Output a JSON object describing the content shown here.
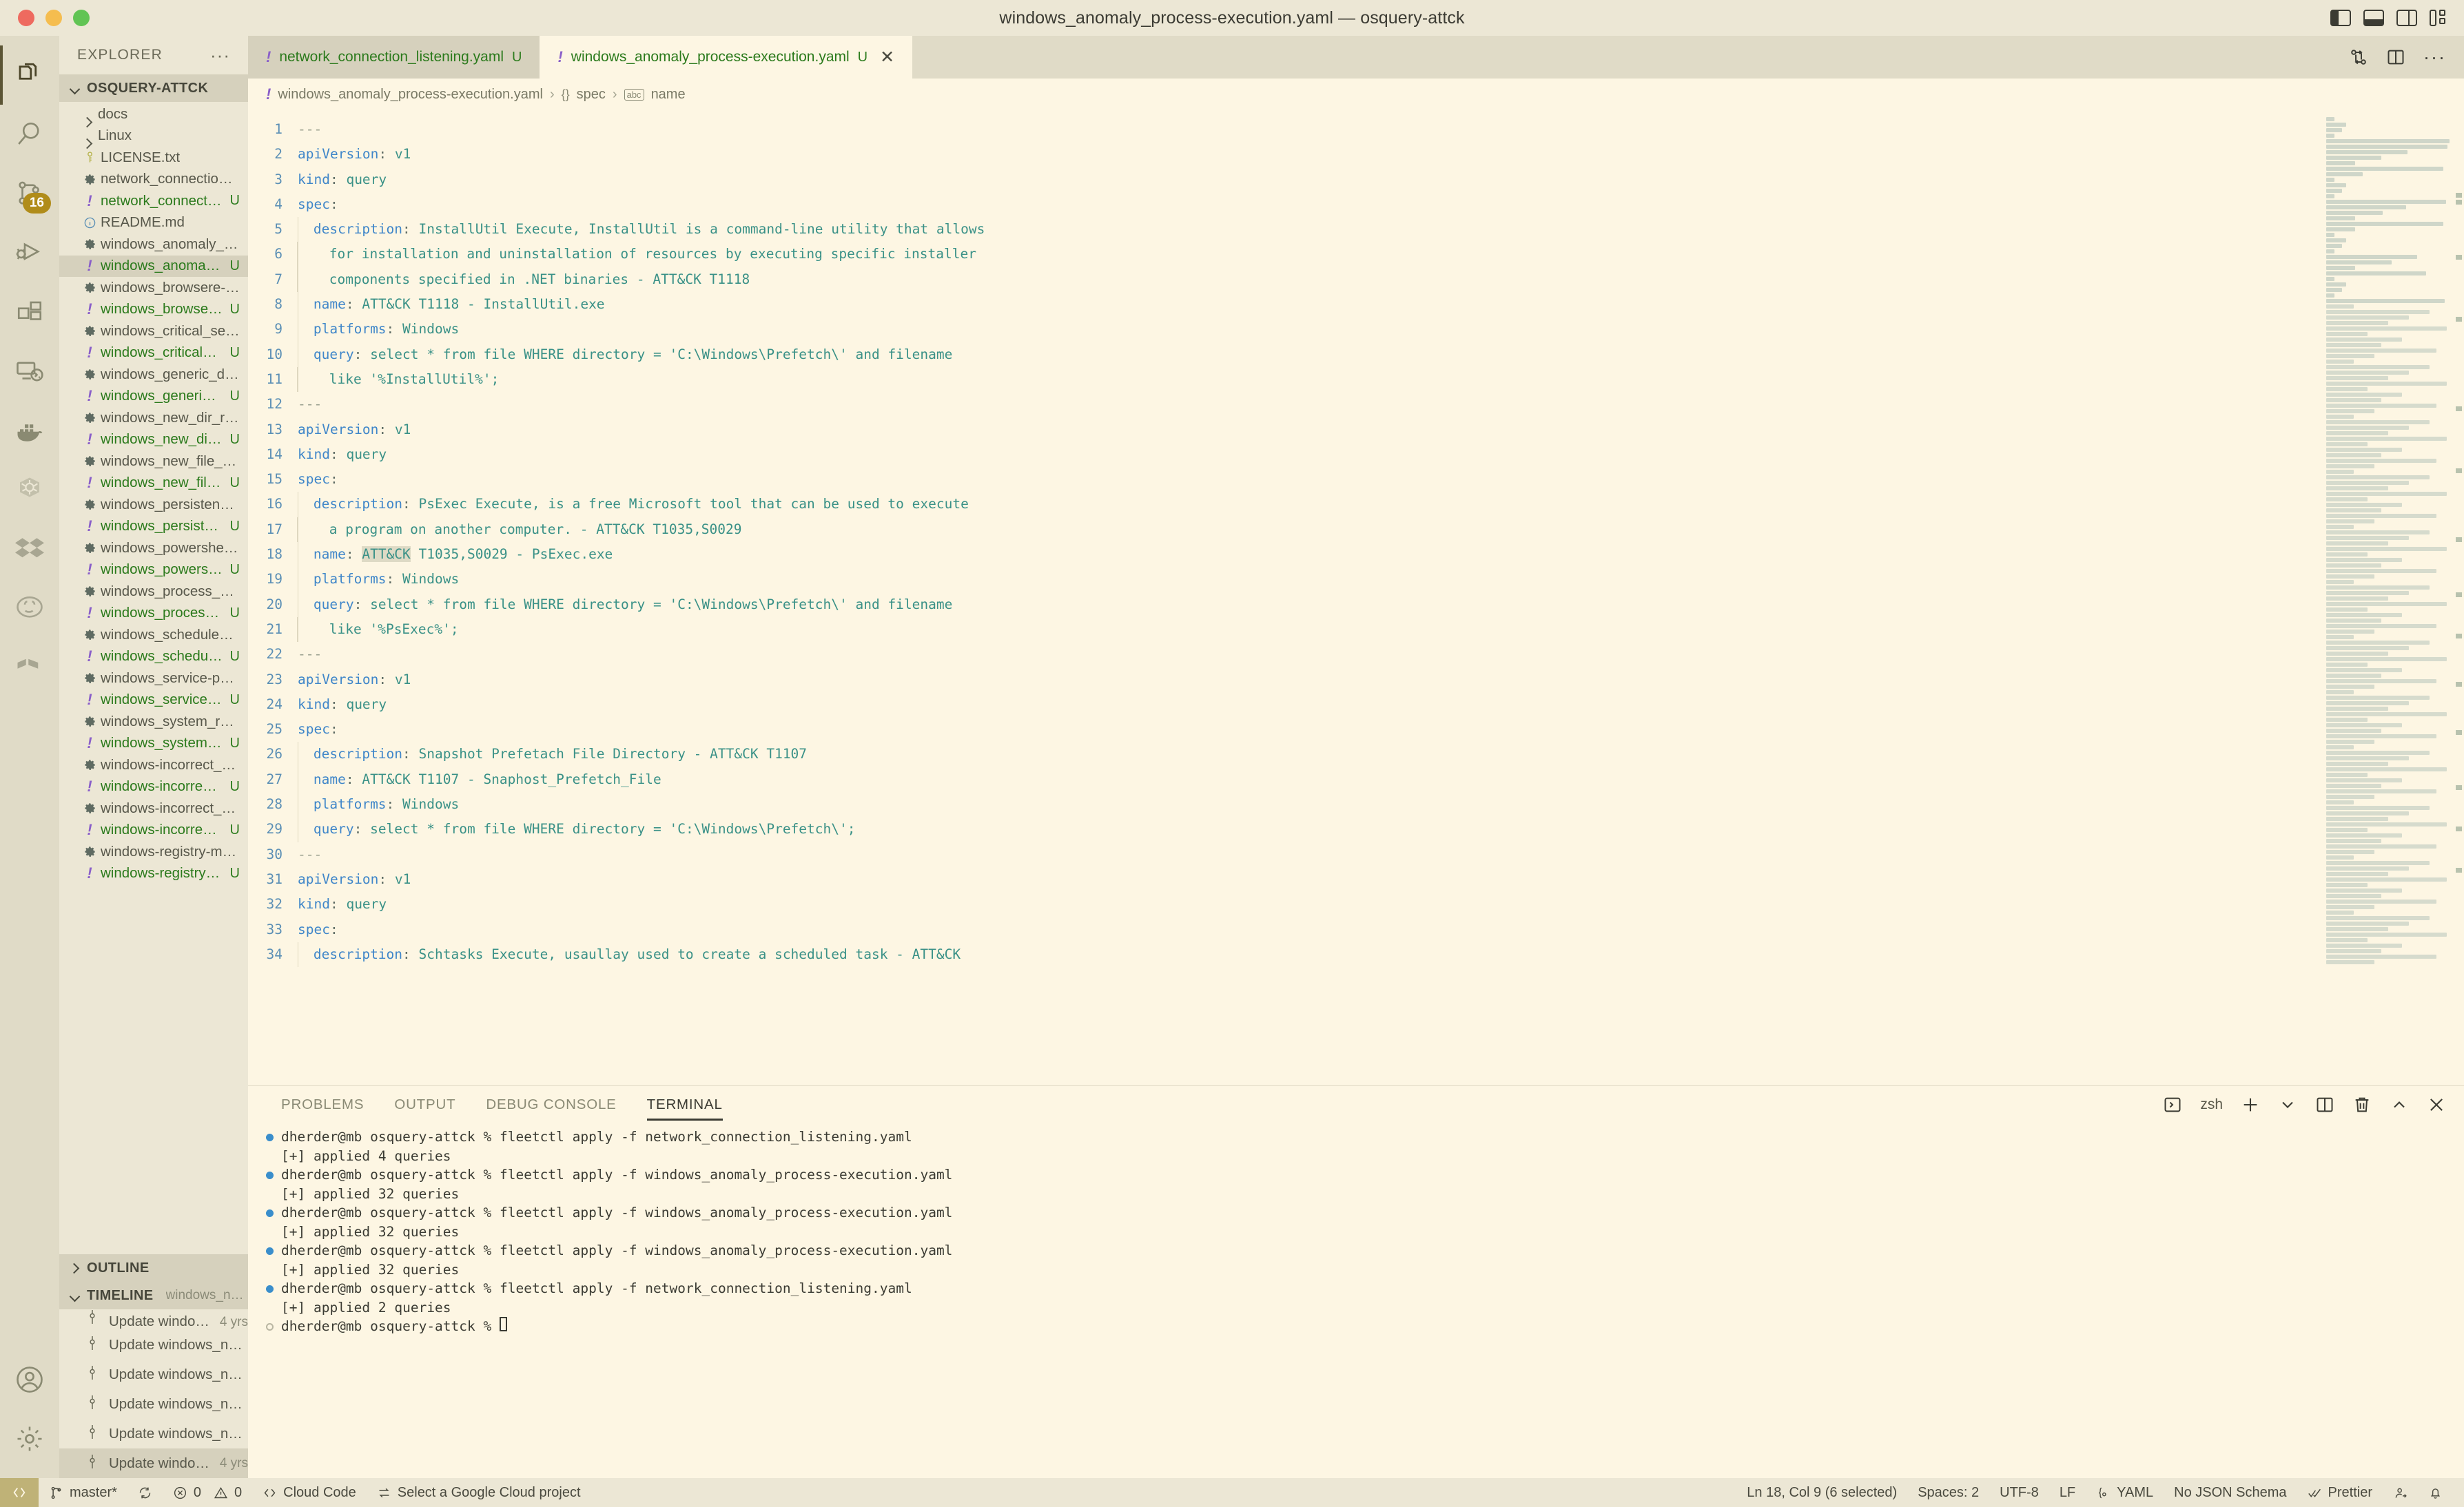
{
  "window": {
    "title": "windows_anomaly_process-execution.yaml — osquery-attck",
    "traffic_lights": [
      "close",
      "minimize",
      "maximize"
    ],
    "layout_toggles": [
      "toggle-primary-sidebar",
      "toggle-panel",
      "toggle-secondary-sidebar",
      "customize-layout"
    ]
  },
  "activitybar": {
    "items": [
      {
        "name": "explorer",
        "active": true
      },
      {
        "name": "search",
        "active": false
      },
      {
        "name": "source-control",
        "active": false,
        "badge": "16"
      },
      {
        "name": "run-and-debug",
        "active": false
      },
      {
        "name": "extensions",
        "active": false
      },
      {
        "name": "remote-explorer",
        "active": false
      },
      {
        "name": "docker",
        "active": false
      },
      {
        "name": "kubernetes",
        "active": false
      },
      {
        "name": "dropbox",
        "active": false
      },
      {
        "name": "github",
        "active": false
      },
      {
        "name": "todo-tree",
        "active": false
      }
    ],
    "bottom": [
      {
        "name": "accounts"
      },
      {
        "name": "settings-gear"
      }
    ]
  },
  "sidebar": {
    "header": "EXPLORER",
    "more_actions": "···",
    "folder": "OSQUERY-ATTCK",
    "files": [
      {
        "name": "docs",
        "type": "folder",
        "badge": ""
      },
      {
        "name": "Linux",
        "type": "folder",
        "badge": ""
      },
      {
        "name": "LICENSE.txt",
        "type": "license",
        "badge": ""
      },
      {
        "name": "network_connection_listening.conf",
        "type": "conf",
        "badge": ""
      },
      {
        "name": "network_connection_listening.yaml",
        "type": "yaml",
        "badge": "U"
      },
      {
        "name": "README.md",
        "type": "readme",
        "badge": ""
      },
      {
        "name": "windows_anomaly_process-execution.conf",
        "type": "conf",
        "badge": ""
      },
      {
        "name": "windows_anomaly_process-execution.yaml",
        "type": "yaml",
        "badge": "U",
        "selected": true
      },
      {
        "name": "windows_browsere-extensions.conf",
        "type": "conf",
        "badge": ""
      },
      {
        "name": "windows_browsere-extensions.yaml",
        "type": "yaml",
        "badge": "U"
      },
      {
        "name": "windows_critical_service_status.conf",
        "type": "conf",
        "badge": ""
      },
      {
        "name": "windows_critical_service_status.yaml",
        "type": "yaml",
        "badge": "U"
      },
      {
        "name": "windows_generic_detection.conf",
        "type": "conf",
        "badge": ""
      },
      {
        "name": "windows_generic_detection.yaml",
        "type": "yaml",
        "badge": "U"
      },
      {
        "name": "windows_new_dir_relevant_infection_path.conf",
        "type": "conf",
        "badge": ""
      },
      {
        "name": "windows_new_dir_relevant_infection_path.yaml",
        "type": "yaml",
        "badge": "U"
      },
      {
        "name": "windows_new_file_relevant_infection_path.conf",
        "type": "conf",
        "badge": ""
      },
      {
        "name": "windows_new_file_relevant_infection_path.yaml",
        "type": "yaml",
        "badge": "U"
      },
      {
        "name": "windows_persistence-startup_items.conf",
        "type": "conf",
        "badge": ""
      },
      {
        "name": "windows_persistence-startup_items.yaml",
        "type": "yaml",
        "badge": "U"
      },
      {
        "name": "windows_powershell_events.conf",
        "type": "conf",
        "badge": ""
      },
      {
        "name": "windows_powershell_events.yaml",
        "type": "yaml",
        "badge": "U"
      },
      {
        "name": "windows_process_no_disk_binary.conf",
        "type": "conf",
        "badge": ""
      },
      {
        "name": "windows_process_no_disk_binary.yaml",
        "type": "yaml",
        "badge": "U"
      },
      {
        "name": "windows_scheduled_tasks.conf",
        "type": "conf",
        "badge": ""
      },
      {
        "name": "windows_scheduled_tasks.yaml",
        "type": "yaml",
        "badge": "U"
      },
      {
        "name": "windows_service-persistence.conf",
        "type": "conf",
        "badge": ""
      },
      {
        "name": "windows_service-persistence.yaml",
        "type": "yaml",
        "badge": "U"
      },
      {
        "name": "windows_system_running_processes.conf",
        "type": "conf",
        "badge": ""
      },
      {
        "name": "windows_system_running_processes.yaml",
        "type": "yaml",
        "badge": "U"
      },
      {
        "name": "windows-incorrect_parent_process.conf",
        "type": "conf",
        "badge": ""
      },
      {
        "name": "windows-incorrect_parent_process.yaml",
        "type": "yaml",
        "badge": "U"
      },
      {
        "name": "windows-incorrect_path_process.conf",
        "type": "conf",
        "badge": ""
      },
      {
        "name": "windows-incorrect_path_process.yaml",
        "type": "yaml",
        "badge": "U"
      },
      {
        "name": "windows-registry-monitoring.conf",
        "type": "conf",
        "badge": ""
      },
      {
        "name": "windows-registry-monitoring.yaml",
        "type": "yaml",
        "badge": "U"
      }
    ],
    "outline": {
      "label": "OUTLINE",
      "expanded": false
    },
    "timeline": {
      "label": "TIMELINE",
      "subtitle": "windows_new_file_relevant_infection_path.conf (pi...",
      "entries": [
        {
          "text": "Update windows_new_file_relevant_infectio...",
          "age": "4 yrs",
          "clipped": true
        },
        {
          "text": "Update windows_new_file_relevant_infection_p...",
          "age": ""
        },
        {
          "text": "Update windows_new_file_relevant_infection_p...",
          "age": ""
        },
        {
          "text": "Update windows_new_file_relevant_infection_p...",
          "age": ""
        },
        {
          "text": "Update windows_new_file_relevant_infection_p...",
          "age": ""
        },
        {
          "text": "Update windows_new_file_relevant_infectio...",
          "age": "4 yrs",
          "selected": true
        }
      ]
    }
  },
  "editor": {
    "tabs": [
      {
        "label": "network_connection_listening.yaml",
        "badge": "U",
        "active": false,
        "closable": false
      },
      {
        "label": "windows_anomaly_process-execution.yaml",
        "badge": "U",
        "active": true,
        "closable": true,
        "close": "✕"
      }
    ],
    "actions": [
      "split-editor-toggle",
      "split-editor",
      "more-actions"
    ],
    "breadcrumb": [
      {
        "text": "windows_anomaly_process-execution.yaml",
        "icon": "yaml-icon"
      },
      {
        "text": "spec",
        "icon": "{}"
      },
      {
        "text": "name",
        "icon": "abc"
      }
    ],
    "lines": [
      {
        "n": 1,
        "segs": [
          {
            "t": "---",
            "c": "cm"
          }
        ]
      },
      {
        "n": 2,
        "segs": [
          {
            "t": "apiVersion",
            "c": "k"
          },
          {
            "t": ": ",
            "c": "p"
          },
          {
            "t": "v1",
            "c": "v"
          }
        ]
      },
      {
        "n": 3,
        "segs": [
          {
            "t": "kind",
            "c": "k"
          },
          {
            "t": ": ",
            "c": "p"
          },
          {
            "t": "query",
            "c": "v"
          }
        ]
      },
      {
        "n": 4,
        "segs": [
          {
            "t": "spec",
            "c": "k"
          },
          {
            "t": ":",
            "c": "p"
          }
        ]
      },
      {
        "n": 5,
        "indent": 1,
        "segs": [
          {
            "t": "  description",
            "c": "k"
          },
          {
            "t": ": ",
            "c": "p"
          },
          {
            "t": "InstallUtil Execute, InstallUtil is a command-line utility that allows",
            "c": "v"
          }
        ]
      },
      {
        "n": 6,
        "indent": 2,
        "segs": [
          {
            "t": "    for installation and uninstallation of resources by executing specific installer",
            "c": "v"
          }
        ]
      },
      {
        "n": 7,
        "indent": 2,
        "segs": [
          {
            "t": "    components specified in .NET binaries - ATT&CK T1118",
            "c": "v"
          }
        ]
      },
      {
        "n": 8,
        "indent": 1,
        "segs": [
          {
            "t": "  name",
            "c": "k"
          },
          {
            "t": ": ",
            "c": "p"
          },
          {
            "t": "ATT&CK T1118 - InstallUtil.exe",
            "c": "v"
          }
        ]
      },
      {
        "n": 9,
        "indent": 1,
        "segs": [
          {
            "t": "  platforms",
            "c": "k"
          },
          {
            "t": ": ",
            "c": "p"
          },
          {
            "t": "Windows",
            "c": "v"
          }
        ]
      },
      {
        "n": 10,
        "indent": 1,
        "segs": [
          {
            "t": "  query",
            "c": "k"
          },
          {
            "t": ": ",
            "c": "p"
          },
          {
            "t": "select * from file WHERE directory = 'C:\\Windows\\Prefetch\\' and filename",
            "c": "v"
          }
        ]
      },
      {
        "n": 11,
        "indent": 2,
        "segs": [
          {
            "t": "    like '%InstallUtil%';",
            "c": "v"
          }
        ]
      },
      {
        "n": 12,
        "segs": [
          {
            "t": "---",
            "c": "cm"
          }
        ]
      },
      {
        "n": 13,
        "segs": [
          {
            "t": "apiVersion",
            "c": "k"
          },
          {
            "t": ": ",
            "c": "p"
          },
          {
            "t": "v1",
            "c": "v"
          }
        ]
      },
      {
        "n": 14,
        "segs": [
          {
            "t": "kind",
            "c": "k"
          },
          {
            "t": ": ",
            "c": "p"
          },
          {
            "t": "query",
            "c": "v"
          }
        ]
      },
      {
        "n": 15,
        "segs": [
          {
            "t": "spec",
            "c": "k"
          },
          {
            "t": ":",
            "c": "p"
          }
        ]
      },
      {
        "n": 16,
        "indent": 1,
        "segs": [
          {
            "t": "  description",
            "c": "k"
          },
          {
            "t": ": ",
            "c": "p"
          },
          {
            "t": "PsExec Execute, is a free Microsoft tool that can be used to execute",
            "c": "v"
          }
        ]
      },
      {
        "n": 17,
        "indent": 2,
        "segs": [
          {
            "t": "    a program on another computer. - ATT&CK T1035,S0029",
            "c": "v"
          }
        ]
      },
      {
        "n": 18,
        "indent": 1,
        "segs": [
          {
            "t": "  name",
            "c": "k"
          },
          {
            "t": ": ",
            "c": "p"
          },
          {
            "t": "ATT&CK",
            "c": "v",
            "sel": true
          },
          {
            "t": " T1035,S0029 - PsExec.exe",
            "c": "v"
          }
        ]
      },
      {
        "n": 19,
        "indent": 1,
        "segs": [
          {
            "t": "  platforms",
            "c": "k"
          },
          {
            "t": ": ",
            "c": "p"
          },
          {
            "t": "Windows",
            "c": "v"
          }
        ]
      },
      {
        "n": 20,
        "indent": 1,
        "segs": [
          {
            "t": "  query",
            "c": "k"
          },
          {
            "t": ": ",
            "c": "p"
          },
          {
            "t": "select * from file WHERE directory = 'C:\\Windows\\Prefetch\\' and filename",
            "c": "v"
          }
        ]
      },
      {
        "n": 21,
        "indent": 2,
        "segs": [
          {
            "t": "    like '%PsExec%';",
            "c": "v"
          }
        ]
      },
      {
        "n": 22,
        "segs": [
          {
            "t": "---",
            "c": "cm"
          }
        ]
      },
      {
        "n": 23,
        "segs": [
          {
            "t": "apiVersion",
            "c": "k"
          },
          {
            "t": ": ",
            "c": "p"
          },
          {
            "t": "v1",
            "c": "v"
          }
        ]
      },
      {
        "n": 24,
        "segs": [
          {
            "t": "kind",
            "c": "k"
          },
          {
            "t": ": ",
            "c": "p"
          },
          {
            "t": "query",
            "c": "v"
          }
        ]
      },
      {
        "n": 25,
        "segs": [
          {
            "t": "spec",
            "c": "k"
          },
          {
            "t": ":",
            "c": "p"
          }
        ]
      },
      {
        "n": 26,
        "indent": 1,
        "segs": [
          {
            "t": "  description",
            "c": "k"
          },
          {
            "t": ": ",
            "c": "p"
          },
          {
            "t": "Snapshot Prefetach File Directory - ATT&CK T1107",
            "c": "v"
          }
        ]
      },
      {
        "n": 27,
        "indent": 1,
        "segs": [
          {
            "t": "  name",
            "c": "k"
          },
          {
            "t": ": ",
            "c": "p"
          },
          {
            "t": "ATT&CK T1107 - Snaphost_Prefetch_File",
            "c": "v"
          }
        ]
      },
      {
        "n": 28,
        "indent": 1,
        "segs": [
          {
            "t": "  platforms",
            "c": "k"
          },
          {
            "t": ": ",
            "c": "p"
          },
          {
            "t": "Windows",
            "c": "v"
          }
        ]
      },
      {
        "n": 29,
        "indent": 1,
        "segs": [
          {
            "t": "  query",
            "c": "k"
          },
          {
            "t": ": ",
            "c": "p"
          },
          {
            "t": "select * from file WHERE directory = 'C:\\Windows\\Prefetch\\';",
            "c": "v"
          }
        ]
      },
      {
        "n": 30,
        "segs": [
          {
            "t": "---",
            "c": "cm"
          }
        ]
      },
      {
        "n": 31,
        "segs": [
          {
            "t": "apiVersion",
            "c": "k"
          },
          {
            "t": ": ",
            "c": "p"
          },
          {
            "t": "v1",
            "c": "v"
          }
        ]
      },
      {
        "n": 32,
        "segs": [
          {
            "t": "kind",
            "c": "k"
          },
          {
            "t": ": ",
            "c": "p"
          },
          {
            "t": "query",
            "c": "v"
          }
        ]
      },
      {
        "n": 33,
        "segs": [
          {
            "t": "spec",
            "c": "k"
          },
          {
            "t": ":",
            "c": "p"
          }
        ]
      },
      {
        "n": 34,
        "indent": 1,
        "segs": [
          {
            "t": "  description",
            "c": "k"
          },
          {
            "t": ": ",
            "c": "p"
          },
          {
            "t": "Schtasks Execute, usaullay used to create a scheduled task - ATT&CK",
            "c": "v"
          }
        ]
      }
    ]
  },
  "panel": {
    "tabs": [
      {
        "label": "PROBLEMS",
        "active": false
      },
      {
        "label": "OUTPUT",
        "active": false
      },
      {
        "label": "DEBUG CONSOLE",
        "active": false
      },
      {
        "label": "TERMINAL",
        "active": true
      }
    ],
    "shell": "zsh",
    "actions": [
      "new-terminal",
      "terminal-dropdown",
      "split-terminal",
      "kill-terminal",
      "maximize-panel",
      "close-panel"
    ],
    "terminal_lines": [
      {
        "dot": "blue",
        "text": "dherder@mb osquery-attck % fleetctl apply -f network_connection_listening.yaml"
      },
      {
        "dot": "none",
        "text": "[+] applied 4 queries"
      },
      {
        "dot": "blue",
        "text": "dherder@mb osquery-attck % fleetctl apply -f windows_anomaly_process-execution.yaml"
      },
      {
        "dot": "none",
        "text": "[+] applied 32 queries"
      },
      {
        "dot": "blue",
        "text": "dherder@mb osquery-attck % fleetctl apply -f windows_anomaly_process-execution.yaml"
      },
      {
        "dot": "none",
        "text": "[+] applied 32 queries"
      },
      {
        "dot": "blue",
        "text": "dherder@mb osquery-attck % fleetctl apply -f windows_anomaly_process-execution.yaml"
      },
      {
        "dot": "none",
        "text": "[+] applied 32 queries"
      },
      {
        "dot": "blue",
        "text": "dherder@mb osquery-attck % fleetctl apply -f network_connection_listening.yaml"
      },
      {
        "dot": "none",
        "text": "[+] applied 2 queries"
      },
      {
        "dot": "hollow",
        "text": "dherder@mb osquery-attck % ",
        "cursor": true
      }
    ]
  },
  "statusbar": {
    "remote": "><",
    "branch": "master*",
    "sync": "sync-icon",
    "errors": "0",
    "warnings": "0",
    "cloud_code": "Cloud Code",
    "gcp_project": "Select a Google Cloud project",
    "cursor": "Ln 18, Col 9 (6 selected)",
    "indent": "Spaces: 2",
    "encoding": "UTF-8",
    "eol": "LF",
    "language": "YAML",
    "schema": "No JSON Schema",
    "formatter": "Prettier",
    "feedback": "feedback-icon",
    "bell": "bell-icon"
  },
  "colors": {
    "bg": "#ece7d5",
    "editor_bg": "#fdf6e3",
    "accent": "#b08c1a",
    "yaml_green": "#2b7a1c",
    "key_blue": "#3f86c9",
    "value_teal": "#3a9187",
    "modified_purple": "#8a5fc9"
  }
}
